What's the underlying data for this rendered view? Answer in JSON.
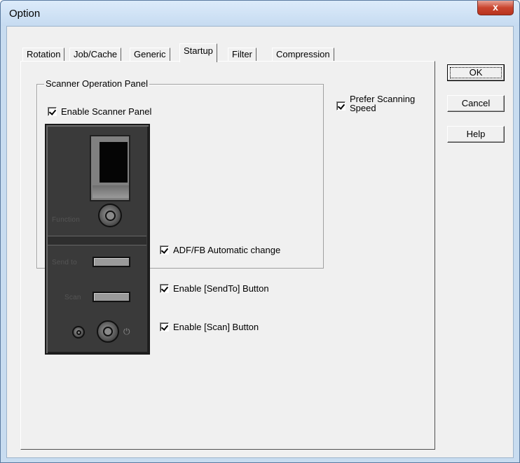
{
  "window": {
    "title": "Option",
    "close_label": "x"
  },
  "tabs": [
    {
      "label": "Rotation",
      "active": false
    },
    {
      "label": "Job/Cache",
      "active": false
    },
    {
      "label": "Generic",
      "active": false
    },
    {
      "label": "Startup",
      "active": true
    },
    {
      "label": "Filter",
      "active": false
    },
    {
      "label": "Compression",
      "active": false
    }
  ],
  "startup": {
    "group_label": "Scanner Operation Panel",
    "enable_panel": {
      "label": "Enable Scanner Panel",
      "checked": true
    },
    "prefer_speed": {
      "label_line1": "Prefer Scanning",
      "label_line2": "Speed",
      "checked": true
    },
    "adf_change": {
      "label": "ADF/FB Automatic change",
      "checked": true
    },
    "sendto_button": {
      "label": "Enable [SendTo] Button",
      "checked": true
    },
    "scan_button": {
      "label": "Enable [Scan] Button",
      "checked": true
    },
    "panel": {
      "function_label": "Function",
      "sendto_label": "Send to",
      "scan_label": "Scan",
      "power_glyph": "⏻"
    }
  },
  "buttons": {
    "ok": "OK",
    "cancel": "Cancel",
    "help": "Help"
  }
}
